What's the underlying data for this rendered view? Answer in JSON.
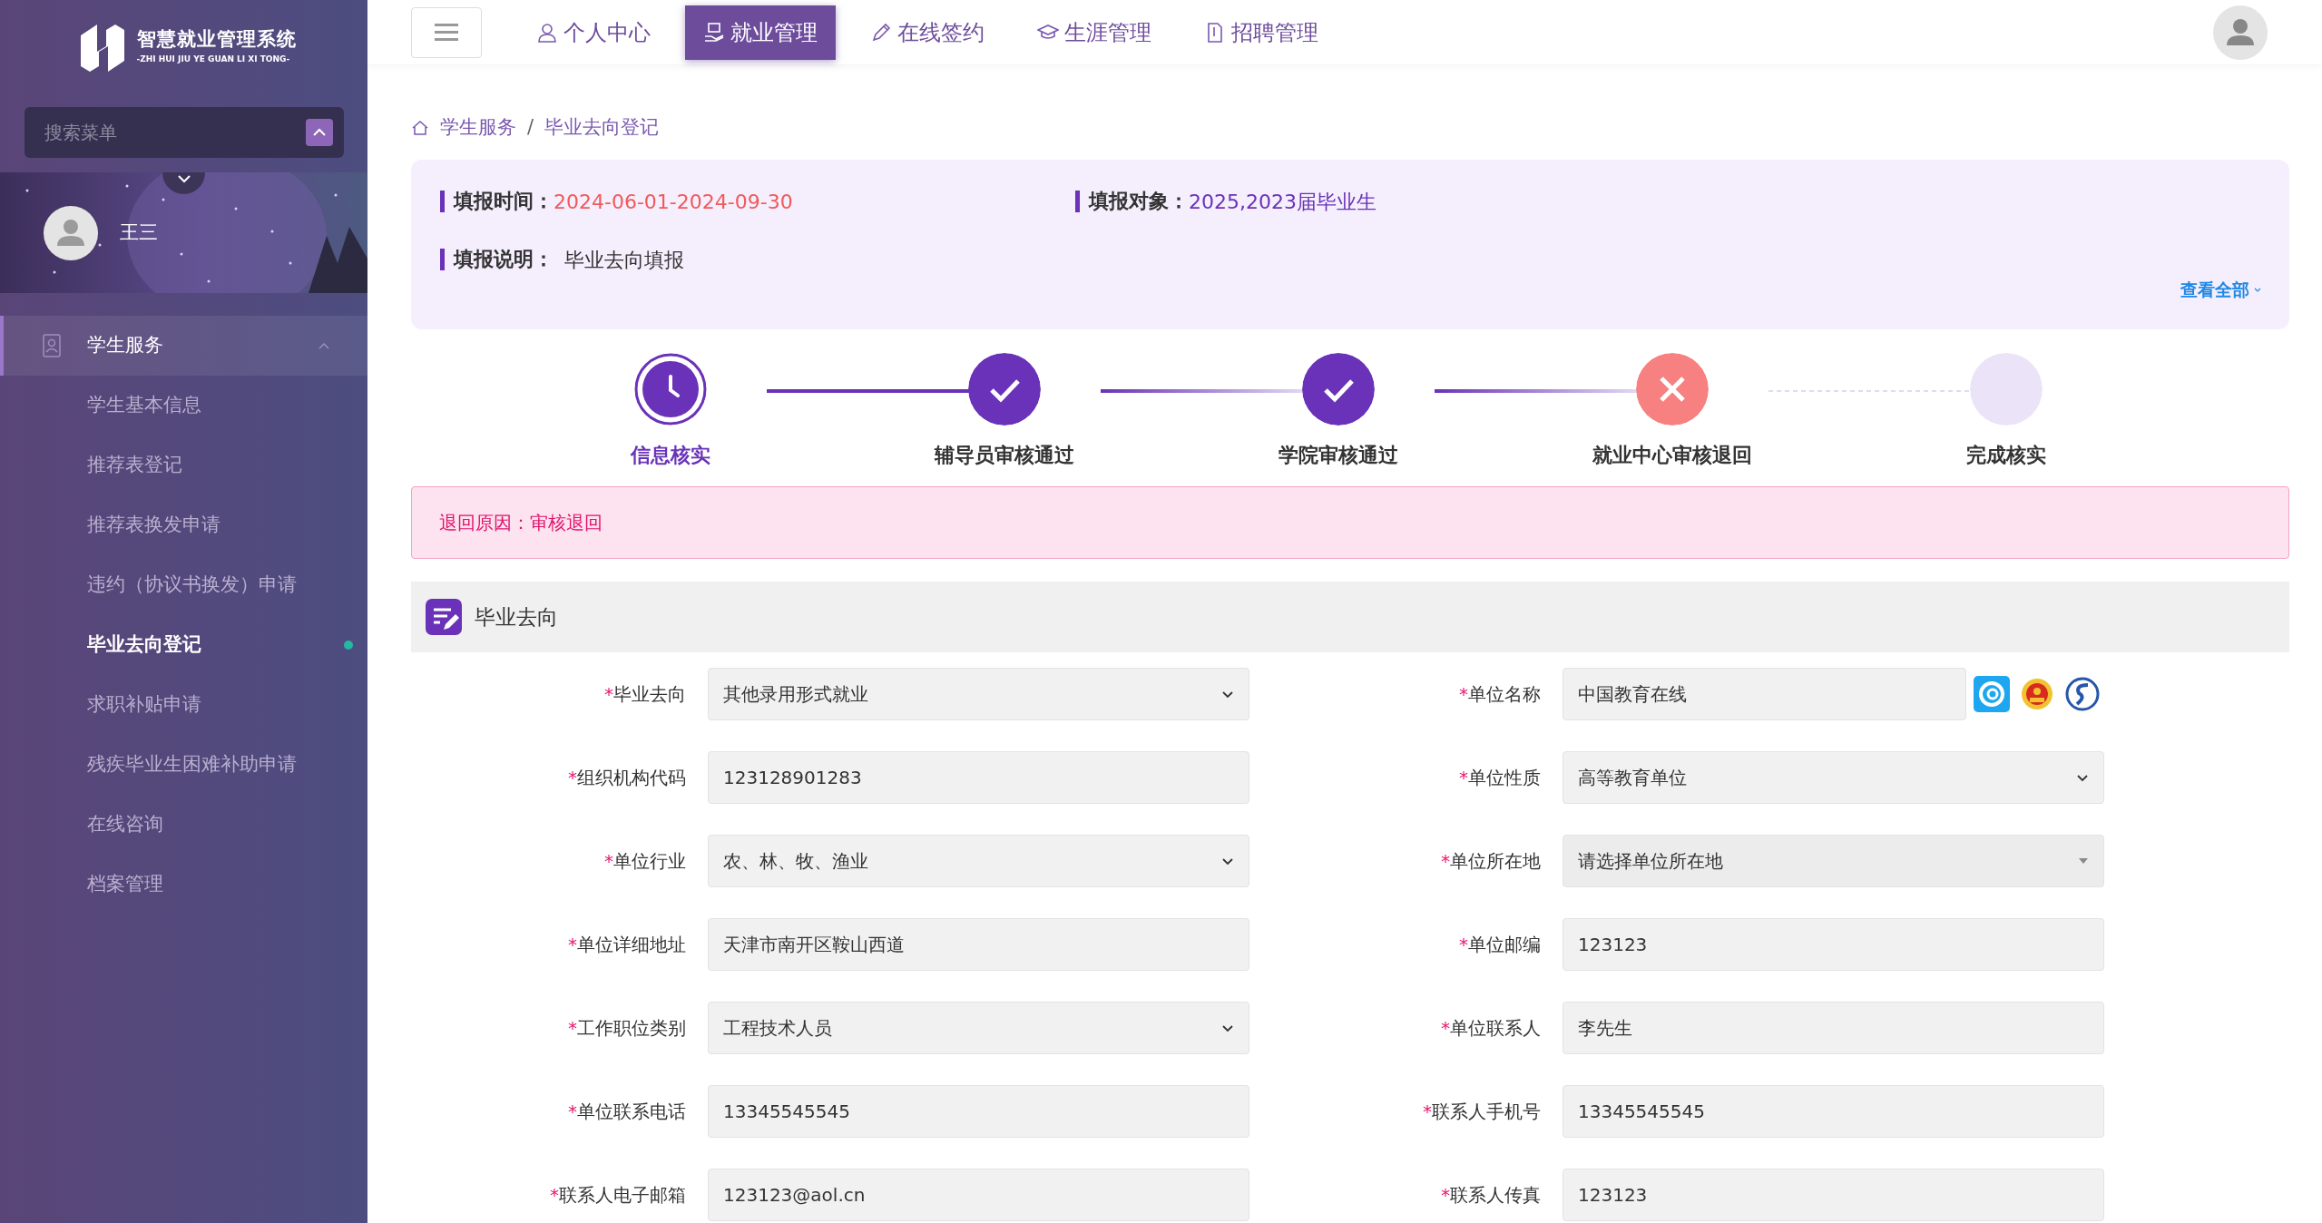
{
  "sidebar": {
    "logo_title": "智慧就业管理系统",
    "logo_subtitle": "-ZHI HUI JIU YE GUAN LI XI TONG-",
    "search": {
      "placeholder": "搜索菜单"
    },
    "user": {
      "name": "王三"
    },
    "menu": [
      {
        "label": "学生服务",
        "expanded": true,
        "children": [
          {
            "label": "学生基本信息",
            "selected": false
          },
          {
            "label": "推荐表登记",
            "selected": false
          },
          {
            "label": "推荐表换发申请",
            "selected": false
          },
          {
            "label": "违约（协议书换发）申请",
            "selected": false
          },
          {
            "label": "毕业去向登记",
            "selected": true
          },
          {
            "label": "求职补贴申请",
            "selected": false
          },
          {
            "label": "残疾毕业生困难补助申请",
            "selected": false
          },
          {
            "label": "在线咨询",
            "selected": false
          },
          {
            "label": "档案管理",
            "selected": false
          }
        ]
      }
    ]
  },
  "top_nav": [
    {
      "label": "个人中心",
      "selected": false
    },
    {
      "label": "就业管理",
      "selected": true
    },
    {
      "label": "在线签约",
      "selected": false
    },
    {
      "label": "生涯管理",
      "selected": false
    },
    {
      "label": "招聘管理",
      "selected": false
    }
  ],
  "breadcrumb": {
    "items": [
      "学生服务",
      "毕业去向登记"
    ],
    "separator": "/"
  },
  "info": {
    "fields": [
      {
        "label": "填报时间：",
        "value": "2024-06-01-2024-09-30",
        "kind": "date"
      },
      {
        "label": "填报对象：",
        "value": "2025,2023届毕业生",
        "kind": "target"
      },
      {
        "label": "填报说明：",
        "value": "毕业去向填报",
        "kind": "plain"
      }
    ],
    "more_link": "查看全部"
  },
  "steps": [
    {
      "label": "信息核实",
      "kind": "current"
    },
    {
      "label": "辅导员审核通过",
      "kind": "done"
    },
    {
      "label": "学院审核通过",
      "kind": "done"
    },
    {
      "label": "就业中心审核退回",
      "kind": "rejected"
    },
    {
      "label": "完成核实",
      "kind": "pending"
    }
  ],
  "alert": {
    "label": "退回原因：",
    "value": "审核退回"
  },
  "section": {
    "title": "毕业去向"
  },
  "form": [
    {
      "required_mark": "*",
      "label": "毕业去向",
      "kind": "select",
      "value": "其他录用形式就业"
    },
    {
      "required_mark": "*",
      "label": "单位名称",
      "kind": "lookup",
      "value": "中国教育在线"
    },
    {
      "required_mark": "*",
      "label": "组织机构代码",
      "kind": "input",
      "value": "123128901283"
    },
    {
      "required_mark": "*",
      "label": "单位性质",
      "kind": "select",
      "value": "高等教育单位"
    },
    {
      "required_mark": "*",
      "label": "单位行业",
      "kind": "select",
      "value": "农、林、牧、渔业"
    },
    {
      "required_mark": "*",
      "label": "单位所在地",
      "kind": "picker",
      "value": "请选择单位所在地"
    },
    {
      "required_mark": "*",
      "label": "单位详细地址",
      "kind": "input",
      "value": "天津市南开区鞍山西道"
    },
    {
      "required_mark": "*",
      "label": "单位邮编",
      "kind": "input",
      "value": "123123"
    },
    {
      "required_mark": "*",
      "label": "工作职位类别",
      "kind": "select",
      "value": "工程技术人员"
    },
    {
      "required_mark": "*",
      "label": "单位联系人",
      "kind": "input",
      "value": "李先生"
    },
    {
      "required_mark": "*",
      "label": "单位联系电话",
      "kind": "input",
      "value": "13345545545"
    },
    {
      "required_mark": "*",
      "label": "联系人手机号",
      "kind": "input",
      "value": "13345545545"
    },
    {
      "required_mark": "*",
      "label": "联系人电子邮箱",
      "kind": "input",
      "value": "123123@aol.cn"
    },
    {
      "required_mark": "*",
      "label": "联系人传真",
      "kind": "input",
      "value": "123123"
    }
  ]
}
